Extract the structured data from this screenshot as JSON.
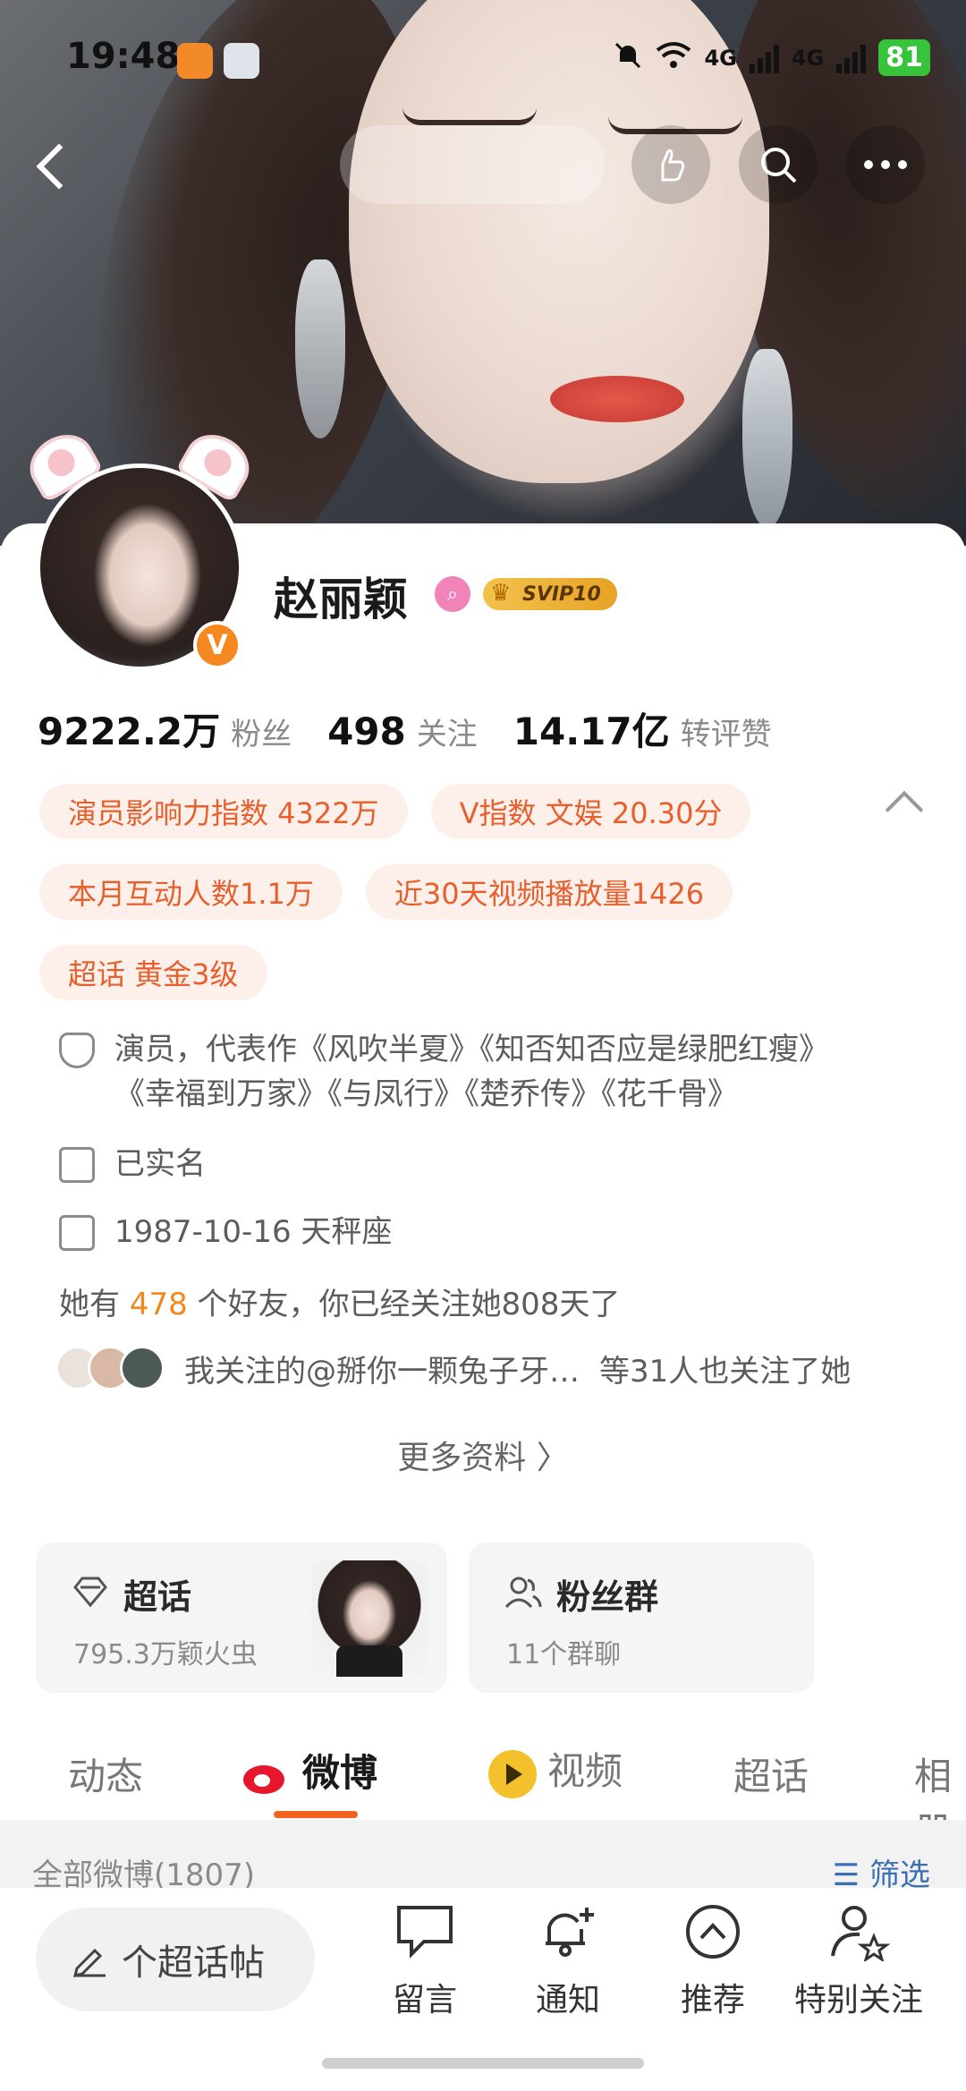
{
  "status_bar": {
    "time": "19:48",
    "battery": "81",
    "network_1": "4G",
    "network_2": "4G"
  },
  "profile": {
    "name": "赵丽颖",
    "vip_badge": "SVIP10",
    "verified_badge": "V"
  },
  "stats": [
    {
      "value": "9222.2万",
      "label": "粉丝"
    },
    {
      "value": "498",
      "label": "关注"
    },
    {
      "value": "14.17亿",
      "label": "转评赞"
    }
  ],
  "tags": [
    "演员影响力指数 4322万",
    "V指数 文娱 20.30分",
    "本月互动人数1.1万",
    "近30天视频播放量1426",
    "超话 黄金3级"
  ],
  "info": {
    "bio_line1": "演员，代表作《风吹半夏》《知否知否应是绿肥红瘦》",
    "bio_line2": "《幸福到万家》《与凤行》《楚乔传》《花千骨》",
    "real_name": "已实名",
    "birthday": "1987-10-16 天秤座"
  },
  "friends": {
    "prefix": "她有",
    "count": "478",
    "suffix": "个好友，你已经关注她808天了"
  },
  "mutual": {
    "text": "我关注的@掰你一颗兔子牙…",
    "extra": "等31人也关注了她"
  },
  "more_info": "更多资料 〉",
  "boxes": {
    "chaohua": {
      "title": "超话",
      "subtitle": "795.3万颖火虫"
    },
    "fan_group": {
      "title": "粉丝群",
      "subtitle": "11个群聊"
    }
  },
  "tabs": [
    "动态",
    "微博",
    "视频",
    "超话",
    "相册"
  ],
  "active_tab": "微博",
  "filter": {
    "left": "全部微博(1807)",
    "right": "筛选"
  },
  "bottom_bar": {
    "compose_placeholder": "个超话帖",
    "items": [
      "留言",
      "通知",
      "推荐",
      "特别关注"
    ]
  },
  "colors": {
    "accent": "#f2631f",
    "tag_text": "#e75f2c",
    "tag_bg": "#fdf0ea",
    "link": "#3b6fb6"
  }
}
